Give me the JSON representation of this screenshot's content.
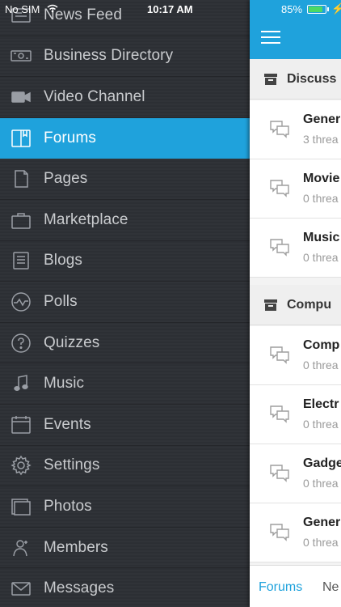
{
  "status_bar": {
    "carrier": "No SIM",
    "time": "10:17 AM",
    "battery_percent": "85%",
    "battery_level": 0.85
  },
  "drawer": {
    "items": [
      {
        "label": "News Feed",
        "icon": "news-feed-icon",
        "active": false
      },
      {
        "label": "Business Directory",
        "icon": "business-directory-icon",
        "active": false
      },
      {
        "label": "Video Channel",
        "icon": "video-camera-icon",
        "active": false
      },
      {
        "label": "Forums",
        "icon": "forums-icon",
        "active": true
      },
      {
        "label": "Pages",
        "icon": "pages-icon",
        "active": false
      },
      {
        "label": "Marketplace",
        "icon": "marketplace-icon",
        "active": false
      },
      {
        "label": "Blogs",
        "icon": "blogs-icon",
        "active": false
      },
      {
        "label": "Polls",
        "icon": "polls-icon",
        "active": false
      },
      {
        "label": "Quizzes",
        "icon": "quizzes-icon",
        "active": false
      },
      {
        "label": "Music",
        "icon": "music-note-icon",
        "active": false
      },
      {
        "label": "Events",
        "icon": "events-calendar-icon",
        "active": false
      },
      {
        "label": "Settings",
        "icon": "settings-gear-icon",
        "active": false
      },
      {
        "label": "Photos",
        "icon": "photos-icon",
        "active": false
      },
      {
        "label": "Members",
        "icon": "members-icon",
        "active": false
      },
      {
        "label": "Messages",
        "icon": "messages-envelope-icon",
        "active": false
      }
    ]
  },
  "forums_panel": {
    "sections": [
      {
        "title": "Discuss",
        "forums": [
          {
            "name": "Gener",
            "meta": "3 threa"
          },
          {
            "name": "Movie",
            "meta": "0 threa"
          },
          {
            "name": "Music",
            "meta": "0 threa"
          }
        ]
      },
      {
        "title": "Compu",
        "forums": [
          {
            "name": "Comp",
            "meta": "0 threa"
          },
          {
            "name": "Electr",
            "meta": "0 threa"
          },
          {
            "name": "Gadge",
            "meta": "0 threa"
          },
          {
            "name": "Gener",
            "meta": "0 threa"
          }
        ]
      }
    ],
    "tabs": {
      "active": "Forums",
      "next": "Ne"
    }
  },
  "colors": {
    "accent": "#1fa2dc",
    "drawer_bg": "#2e3136",
    "drawer_text": "#c9cbce"
  }
}
